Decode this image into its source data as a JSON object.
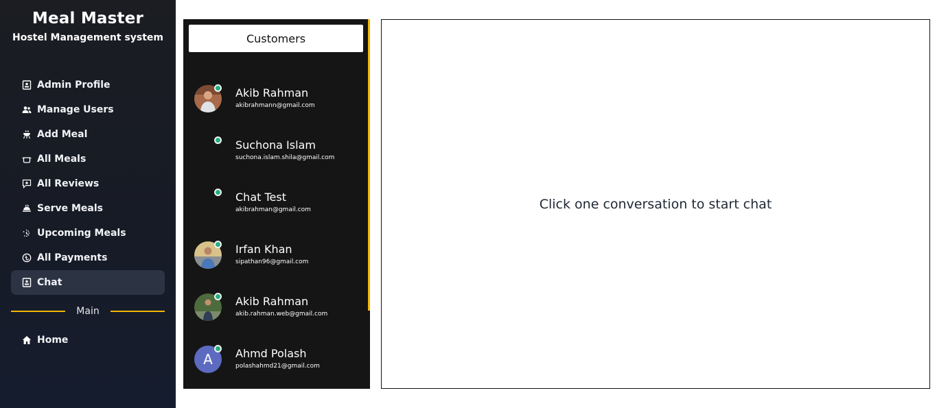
{
  "brand": {
    "title": "Meal Master",
    "subtitle": "Hostel Management system"
  },
  "sidebar": {
    "items": [
      {
        "label": "Admin Profile",
        "icon": "profile-card-icon"
      },
      {
        "label": "Manage Users",
        "icon": "users-icon"
      },
      {
        "label": "Add Meal",
        "icon": "grill-icon"
      },
      {
        "label": "All Meals",
        "icon": "pot-icon"
      },
      {
        "label": "All Reviews",
        "icon": "review-icon"
      },
      {
        "label": "Serve Meals",
        "icon": "cloche-icon"
      },
      {
        "label": "Upcoming Meals",
        "icon": "upcoming-icon"
      },
      {
        "label": "All Payments",
        "icon": "taka-icon"
      },
      {
        "label": "Chat",
        "icon": "chat-icon",
        "active": true
      }
    ],
    "divider_label": "Main",
    "main_items": [
      {
        "label": "Home",
        "icon": "home-icon"
      }
    ],
    "accent_color": "#f5b800"
  },
  "customers": {
    "header": "Customers",
    "list": [
      {
        "name": "Akib Rahman",
        "email": "akibrahmann@gmail.com",
        "avatar": "photo",
        "online": true
      },
      {
        "name": "Suchona Islam",
        "email": "suchona.islam.shila@gmail.com",
        "avatar": "none",
        "online": true
      },
      {
        "name": "Chat Test",
        "email": "akibrahman@gmail.com",
        "avatar": "none",
        "online": true
      },
      {
        "name": "Irfan Khan",
        "email": "sipathan96@gmail.com",
        "avatar": "photo",
        "online": true
      },
      {
        "name": "Akib Rahman",
        "email": "akib.rahman.web@gmail.com",
        "avatar": "photo",
        "online": true
      },
      {
        "name": "Ahmd Polash",
        "email": "polashahmd21@gmail.com",
        "avatar": "letter",
        "avatar_letter": "A",
        "online": true
      }
    ]
  },
  "chat": {
    "placeholder": "Click one conversation to start chat"
  }
}
